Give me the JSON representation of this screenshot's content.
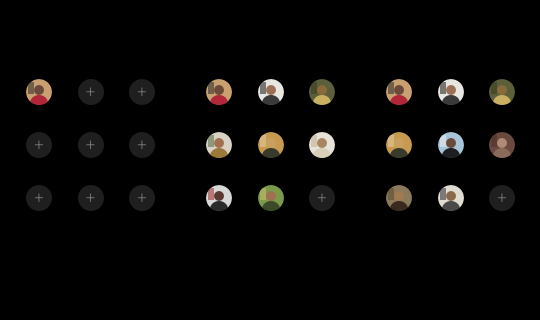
{
  "add_glyph": "+",
  "panels": [
    {
      "slots": [
        {
          "filled": true,
          "palette": {
            "bg": "#c9a070",
            "body": "#b2263a",
            "head": "#6b4a3a",
            "accent": "#2a2a2a"
          }
        },
        {
          "filled": false
        },
        {
          "filled": false
        },
        {
          "filled": false
        },
        {
          "filled": false
        },
        {
          "filled": false
        },
        {
          "filled": false
        },
        {
          "filled": false
        },
        {
          "filled": false
        }
      ]
    },
    {
      "slots": [
        {
          "filled": true,
          "palette": {
            "bg": "#c9a070",
            "body": "#b2263a",
            "head": "#6b4a3a",
            "accent": "#2a2a2a"
          }
        },
        {
          "filled": true,
          "palette": {
            "bg": "#e8e6e0",
            "body": "#3a3a3a",
            "head": "#9c7058",
            "accent": "#1a1a1a"
          }
        },
        {
          "filled": true,
          "palette": {
            "bg": "#5b5f3a",
            "body": "#c8b060",
            "head": "#8a6a3a",
            "accent": "#3c3a22"
          }
        },
        {
          "filled": true,
          "palette": {
            "bg": "#d9d2c4",
            "body": "#9a7a3a",
            "head": "#a07050",
            "accent": "#4a6a3a"
          }
        },
        {
          "filled": true,
          "palette": {
            "bg": "#c79a50",
            "body": "#3a3a2a",
            "head": "#caa060",
            "accent": "#e0d0a0"
          }
        },
        {
          "filled": true,
          "palette": {
            "bg": "#e6e2d8",
            "body": "#d8cfb8",
            "head": "#a98660",
            "accent": "#c0b090"
          }
        },
        {
          "filled": true,
          "palette": {
            "bg": "#d8d8d8",
            "body": "#2a2a2a",
            "head": "#5a3a30",
            "accent": "#9a2a2a"
          }
        },
        {
          "filled": true,
          "palette": {
            "bg": "#7a9a4a",
            "body": "#3a4a2a",
            "head": "#a07050",
            "accent": "#d0c070"
          }
        },
        {
          "filled": false
        }
      ]
    },
    {
      "slots": [
        {
          "filled": true,
          "palette": {
            "bg": "#c9a070",
            "body": "#b2263a",
            "head": "#6b4a3a",
            "accent": "#2a2a2a"
          }
        },
        {
          "filled": true,
          "palette": {
            "bg": "#e8e6e0",
            "body": "#3a3a3a",
            "head": "#9c7058",
            "accent": "#1a1a1a"
          }
        },
        {
          "filled": true,
          "palette": {
            "bg": "#5b5f3a",
            "body": "#c8b060",
            "head": "#8a6a3a",
            "accent": "#3c3a22"
          }
        },
        {
          "filled": true,
          "palette": {
            "bg": "#c79a50",
            "body": "#3a3a2a",
            "head": "#caa060",
            "accent": "#e0d0a0"
          }
        },
        {
          "filled": true,
          "palette": {
            "bg": "#a8c4d8",
            "body": "#1e1e22",
            "head": "#6a4a3a",
            "accent": "#f0f0f0"
          }
        },
        {
          "filled": true,
          "palette": {
            "bg": "#6a4a3e",
            "body": "#8a6a5a",
            "head": "#b08a76",
            "accent": "#4a3026"
          }
        },
        {
          "filled": true,
          "palette": {
            "bg": "#8a7a5a",
            "body": "#3a2a1e",
            "head": "#a07a50",
            "accent": "#5a4a30"
          }
        },
        {
          "filled": true,
          "palette": {
            "bg": "#e0dcd2",
            "body": "#4a4a4a",
            "head": "#8a6a4a",
            "accent": "#2a2a2a"
          }
        },
        {
          "filled": false
        }
      ]
    }
  ]
}
